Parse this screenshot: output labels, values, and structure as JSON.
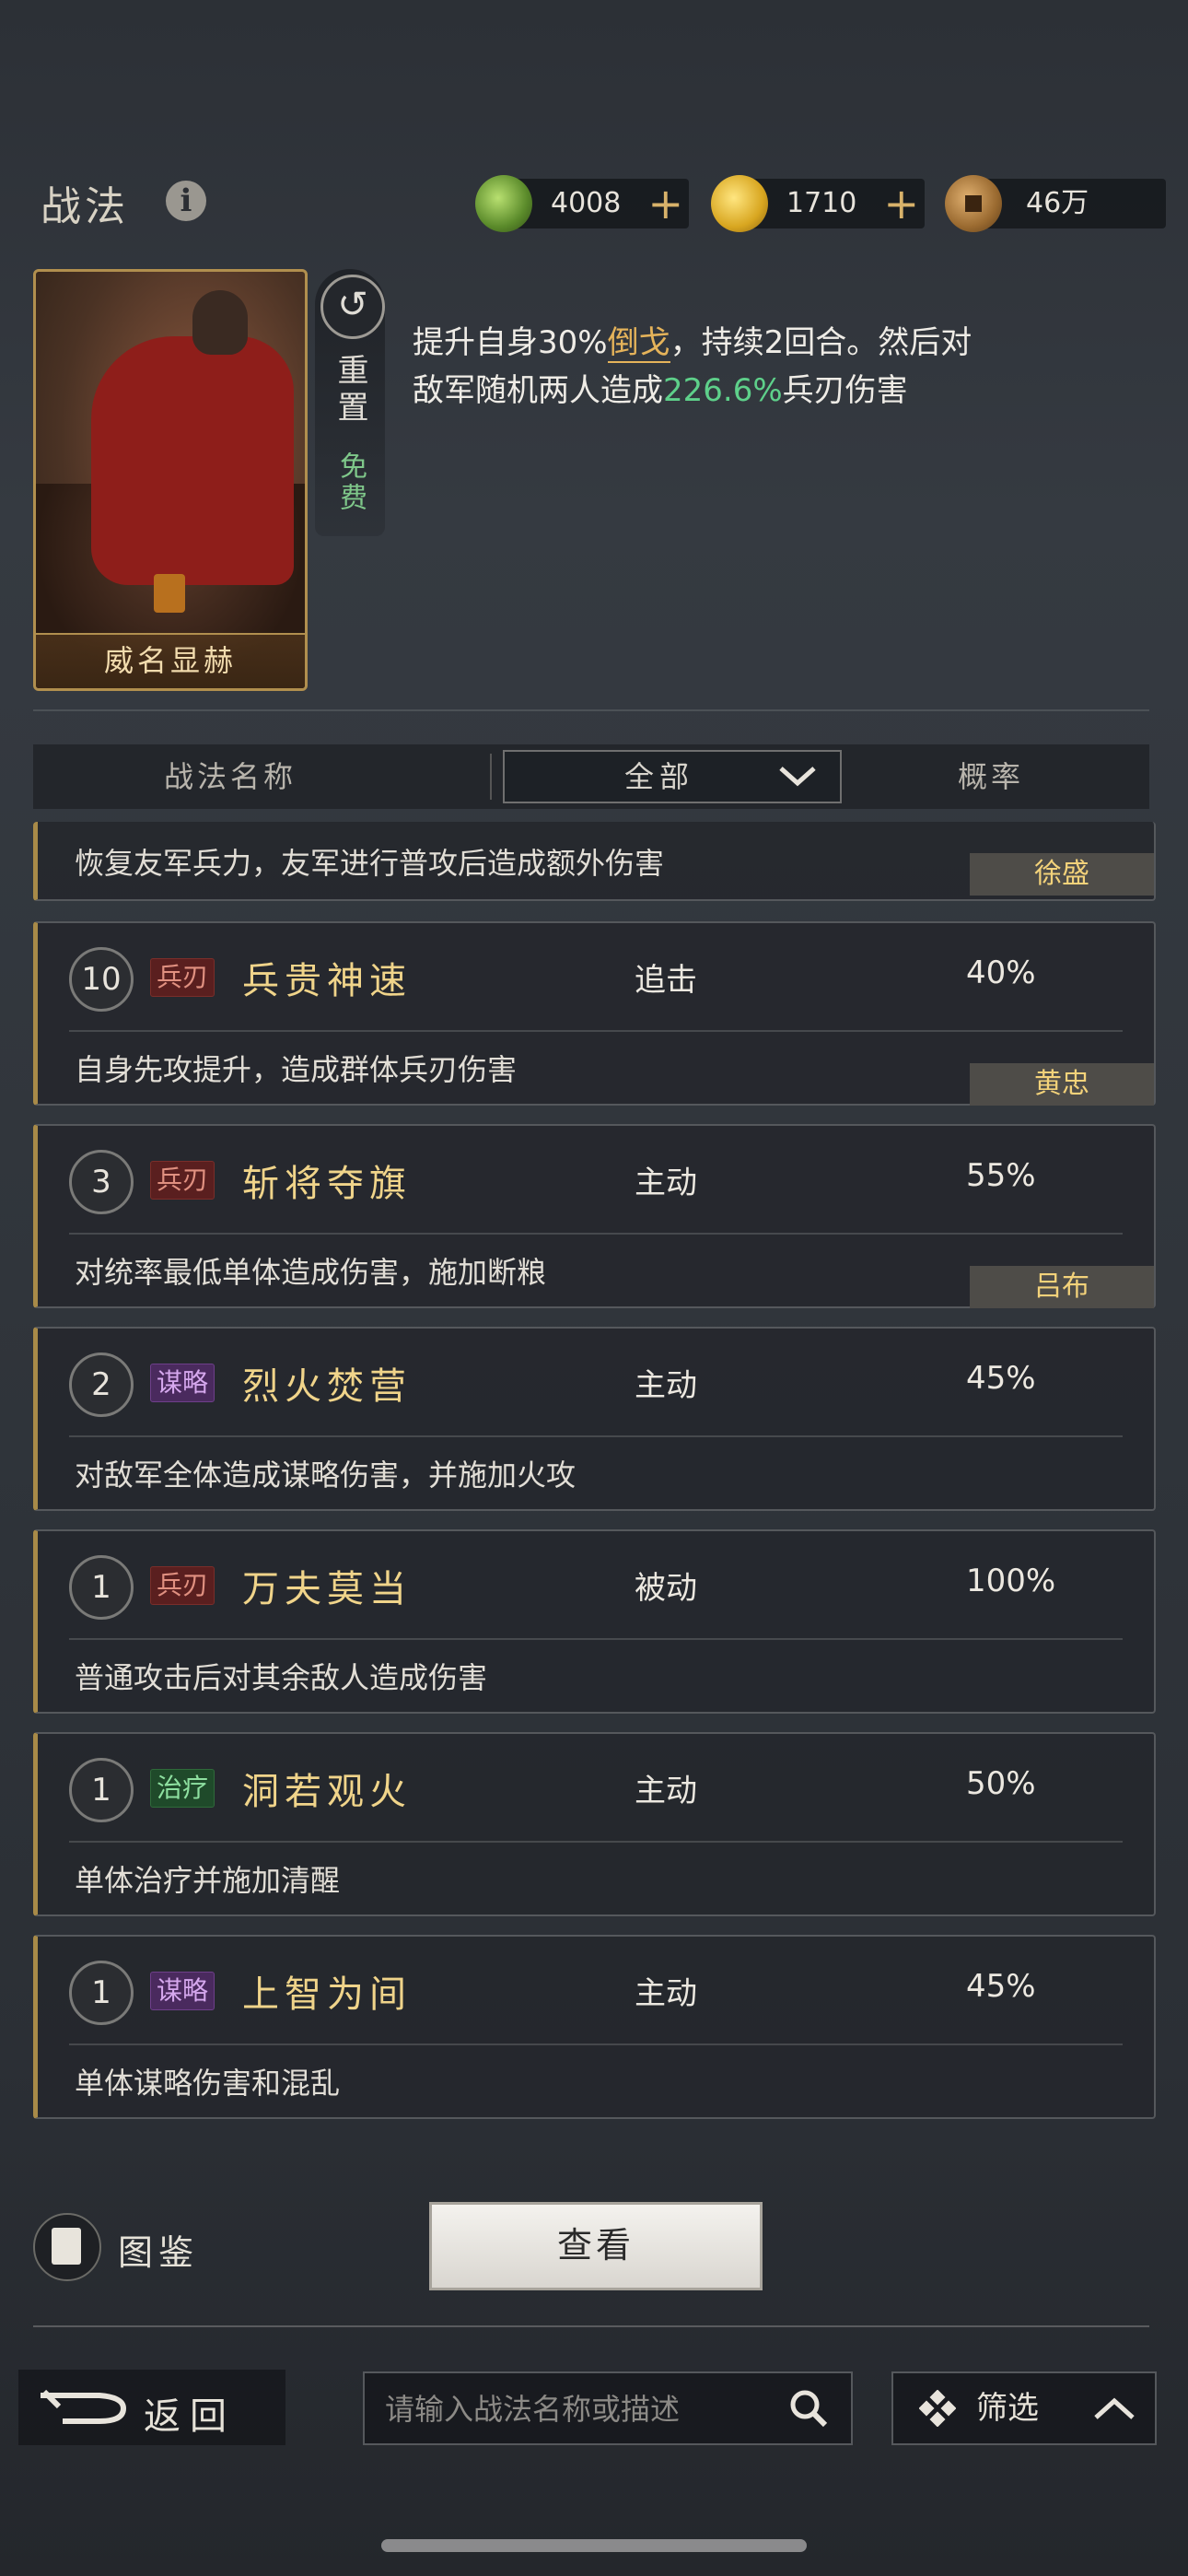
{
  "header": {
    "title": "战法",
    "info_icon": "info-icon",
    "resources": [
      {
        "icon": "jade-icon",
        "value": "4008",
        "has_plus": true
      },
      {
        "icon": "gold-icon",
        "value": "1710",
        "has_plus": true
      },
      {
        "icon": "copper-coin-icon",
        "value": "46万",
        "has_plus": false
      }
    ]
  },
  "selected_skill": {
    "card_name": "威名显赫",
    "reset_label": "重置",
    "free_label": "免费",
    "desc_line1_a": "提升自身30%",
    "desc_line1_hl": "倒戈",
    "desc_line1_b": "，持续2回合。然后对",
    "desc_line2_a": "敌军随机两人造成",
    "desc_line2_value": "226.6%",
    "desc_line2_b": "兵刃伤害"
  },
  "table": {
    "col_name": "战法名称",
    "filter_value": "全部",
    "col_prob": "概率",
    "partial_row": {
      "desc": "恢复友军兵力，友军进行普攻后造成额外伤害",
      "owner": "徐盛"
    },
    "rows": [
      {
        "level": "10",
        "tag": "兵刃",
        "tag_color": "#5a1f1f",
        "name": "兵贵神速",
        "type": "追击",
        "prob": "40%",
        "desc": "自身先攻提升，造成群体兵刃伤害",
        "owner": "黄忠"
      },
      {
        "level": "3",
        "tag": "兵刃",
        "tag_color": "#5a1f1f",
        "name": "斩将夺旗",
        "type": "主动",
        "prob": "55%",
        "desc": "对统率最低单体造成伤害，施加断粮",
        "owner": "吕布"
      },
      {
        "level": "2",
        "tag": "谋略",
        "tag_color": "#4a2a5e",
        "name": "烈火焚营",
        "type": "主动",
        "prob": "45%",
        "desc": "对敌军全体造成谋略伤害，并施加火攻"
      },
      {
        "level": "1",
        "tag": "兵刃",
        "tag_color": "#5a1f1f",
        "name": "万夫莫当",
        "type": "被动",
        "prob": "100%",
        "desc": "普通攻击后对其余敌人造成伤害"
      },
      {
        "level": "1",
        "tag": "治疗",
        "tag_color": "#1f4a2a",
        "name": "洞若观火",
        "type": "主动",
        "prob": "50%",
        "desc": "单体治疗并施加清醒"
      },
      {
        "level": "1",
        "tag": "谋略",
        "tag_color": "#4a2a5e",
        "name": "上智为间",
        "type": "主动",
        "prob": "45%",
        "desc": "单体谋略伤害和混乱"
      }
    ]
  },
  "bottom": {
    "codex_label": "图鉴",
    "view_button": "查看",
    "back_label": "返回",
    "search_placeholder": "请输入战法名称或描述",
    "filter_label": "筛选"
  }
}
